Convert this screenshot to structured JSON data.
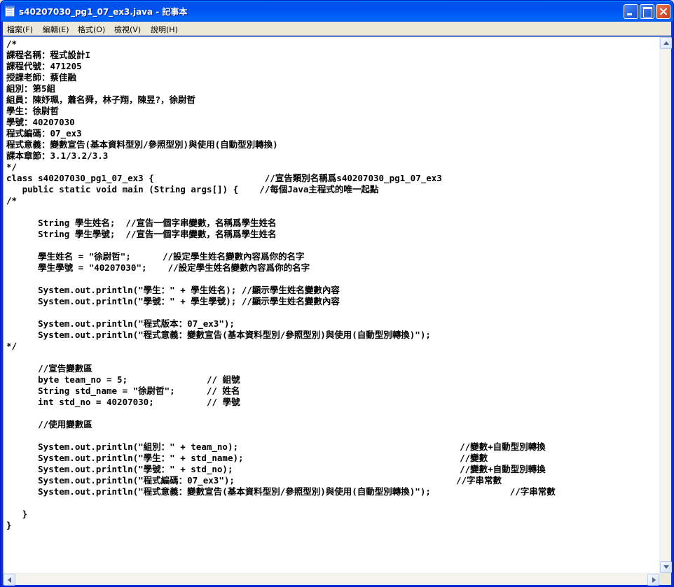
{
  "window": {
    "title": "s40207030_pg1_07_ex3.java - 記事本",
    "minimize_icon": "minimize-icon",
    "maximize_icon": "maximize-icon",
    "close_icon": "close-icon"
  },
  "menu": [
    {
      "label": "檔案(F)"
    },
    {
      "label": "編輯(E)"
    },
    {
      "label": "格式(O)"
    },
    {
      "label": "檢視(V)"
    },
    {
      "label": "說明(H)"
    }
  ],
  "code_lines": [
    "/*",
    "課程名稱：程式設計I",
    "課程代號：471205",
    "授課老師：蔡佳融",
    "組別：第5組",
    "組員：陳妤珮，蕭名舜，林子翔，陳昱?，徐尉哲",
    "學生：徐尉哲",
    "學號：40207030",
    "程式編碼：07_ex3",
    "程式意義：變數宣告(基本資料型別/參照型別)與使用(自動型別轉換)",
    "課本章節：3.1/3.2/3.3",
    "*/",
    "class s40207030_pg1_07_ex3 {                     //宣告類別名稱爲s40207030_pg1_07_ex3",
    "   public static void main (String args[]) {    //每個Java主程式的唯一起點",
    "/*",
    "",
    "      String 學生姓名;  //宣告一個字串變數，名稱爲學生姓名",
    "      String 學生學號;  //宣告一個字串變數，名稱爲學生姓名",
    "",
    "      學生姓名 = \"徐尉哲\";      //設定學生姓名變數內容爲你的名字",
    "      學生學號 = \"40207030\";    //設定學生姓名變數內容爲你的名字",
    "",
    "      System.out.println(\"學生：\" + 學生姓名); //顯示學生姓名變數內容",
    "      System.out.println(\"學號：\" + 學生學號); //顯示學生姓名變數內容",
    "",
    "      System.out.println(\"程式版本：07_ex3\");",
    "      System.out.println(\"程式意義：變數宣告(基本資料型別/參照型別)與使用(自動型別轉換)\");",
    "*/",
    "",
    "      //宣告變數區",
    "      byte team_no = 5;               // 組號",
    "      String std_name = \"徐尉哲\";      // 姓名",
    "      int std_no = 40207030;          // 學號",
    "",
    "      //使用變數區",
    "",
    "      System.out.println(\"組別：\" + team_no);                                          //變數+自動型別轉換",
    "      System.out.println(\"學生：\" + std_name);                                         //變數",
    "      System.out.println(\"學號：\" + std_no);                                           //變數+自動型別轉換",
    "      System.out.println(\"程式編碼：07_ex3\");                                          //字串常數",
    "      System.out.println(\"程式意義：變數宣告(基本資料型別/參照型別)與使用(自動型別轉換)\");               //字串常數",
    "",
    "   }",
    "}"
  ]
}
